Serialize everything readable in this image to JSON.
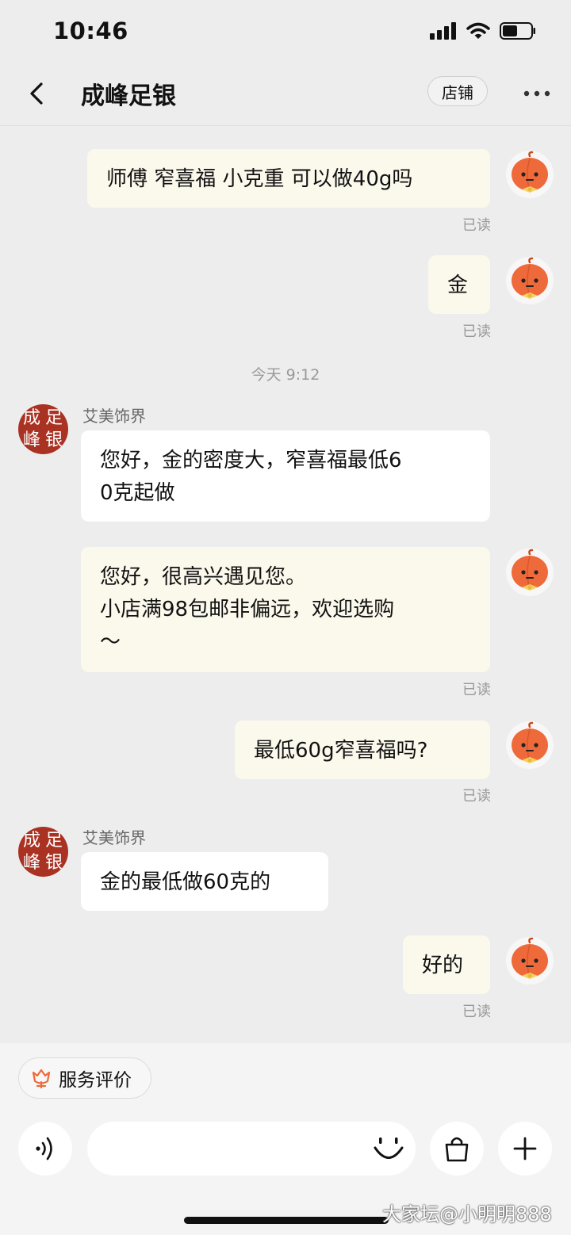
{
  "status_bar": {
    "time": "10:46"
  },
  "header": {
    "title": "成峰足银",
    "shop_button": "店铺"
  },
  "chat": {
    "read_label": "已读",
    "timestamp": "今天 9:12",
    "sender_name": "艾美饰界",
    "shop_avatar_text": [
      "成",
      "足",
      "峰",
      "银"
    ],
    "messages": [
      {
        "from": "me",
        "lines": [
          "师傅 窄喜福 小克重 可以做40g吗"
        ]
      },
      {
        "from": "me",
        "lines": [
          "金"
        ]
      },
      {
        "from": "shop",
        "lines": [
          "您好，金的密度大，窄喜福最低6",
          "0克起做"
        ]
      },
      {
        "from": "me",
        "lines": [
          "您好，很高兴遇见您。",
          "小店满98包邮非偏远，欢迎选购",
          "～"
        ]
      },
      {
        "from": "me",
        "lines": [
          "最低60g窄喜福吗?"
        ]
      },
      {
        "from": "shop",
        "lines": [
          "金的最低做60克的"
        ]
      },
      {
        "from": "me",
        "lines": [
          "好的"
        ]
      }
    ]
  },
  "bottom_bar": {
    "service_rating": "服务评价"
  },
  "watermark": "大家坛@小明明888",
  "icons": {
    "back": "chevron-left-icon",
    "more": "more-dots-icon",
    "voice": "voice-icon",
    "emoji": "smile-icon",
    "bag": "shopping-bag-icon",
    "plus": "plus-icon",
    "flower": "flower-icon"
  },
  "colors": {
    "accent": "#ef6a3a",
    "my_bubble": "#fbf8ec",
    "their_bubble": "#ffffff",
    "background": "#ededed",
    "shop_avatar": "#a93223"
  }
}
